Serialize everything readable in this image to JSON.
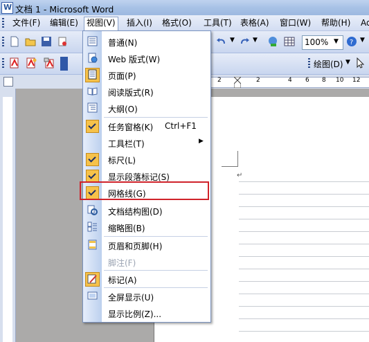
{
  "window": {
    "title": "文档 1 - Microsoft Word"
  },
  "menubar": {
    "items": [
      "文件(F)",
      "编辑(E)",
      "视图(V)",
      "插入(I)",
      "格式(O)",
      "工具(T)",
      "表格(A)",
      "窗口(W)",
      "帮助(H)",
      "Ad"
    ],
    "active": "视图(V)"
  },
  "toolbar": {
    "zoom": "100%",
    "drawing_label": "绘图(D)"
  },
  "ruler": {
    "ticks": [
      "2",
      "2",
      "4",
      "6",
      "8",
      "10",
      "12"
    ]
  },
  "view_menu": {
    "items": [
      {
        "label": "普通(N)",
        "icon": "normal-view-icon"
      },
      {
        "label": "Web 版式(W)",
        "icon": "web-layout-icon"
      },
      {
        "label": "页面(P)",
        "icon": "print-layout-icon"
      },
      {
        "label": "阅读版式(R)",
        "icon": "reading-layout-icon"
      },
      {
        "label": "大纲(O)",
        "icon": "outline-icon"
      },
      {
        "label": "任务窗格(K)",
        "shortcut": "Ctrl+F1",
        "checked": true
      },
      {
        "label": "工具栏(T)",
        "submenu": true
      },
      {
        "label": "标尺(L)",
        "checked": true
      },
      {
        "label": "显示段落标记(S)",
        "checked": true
      },
      {
        "label": "网格线(G)",
        "checked": true,
        "highlighted": true
      },
      {
        "label": "文档结构图(D)",
        "icon": "document-map-icon"
      },
      {
        "label": "缩略图(B)",
        "icon": "thumbnails-icon"
      },
      {
        "label": "页眉和页脚(H)",
        "icon": "header-footer-icon"
      },
      {
        "label": "脚注(F)",
        "disabled": true
      },
      {
        "label": "标记(A)",
        "icon": "markup-icon"
      },
      {
        "label": "全屏显示(U)",
        "icon": "full-screen-icon"
      },
      {
        "label": "显示比例(Z)..."
      }
    ]
  },
  "document": {
    "paragraph_mark": "↵"
  },
  "colors": {
    "highlight_border": "#d0222a",
    "check_bg": "#f6c24a",
    "menu_icon_column": "#c7d7f0"
  }
}
